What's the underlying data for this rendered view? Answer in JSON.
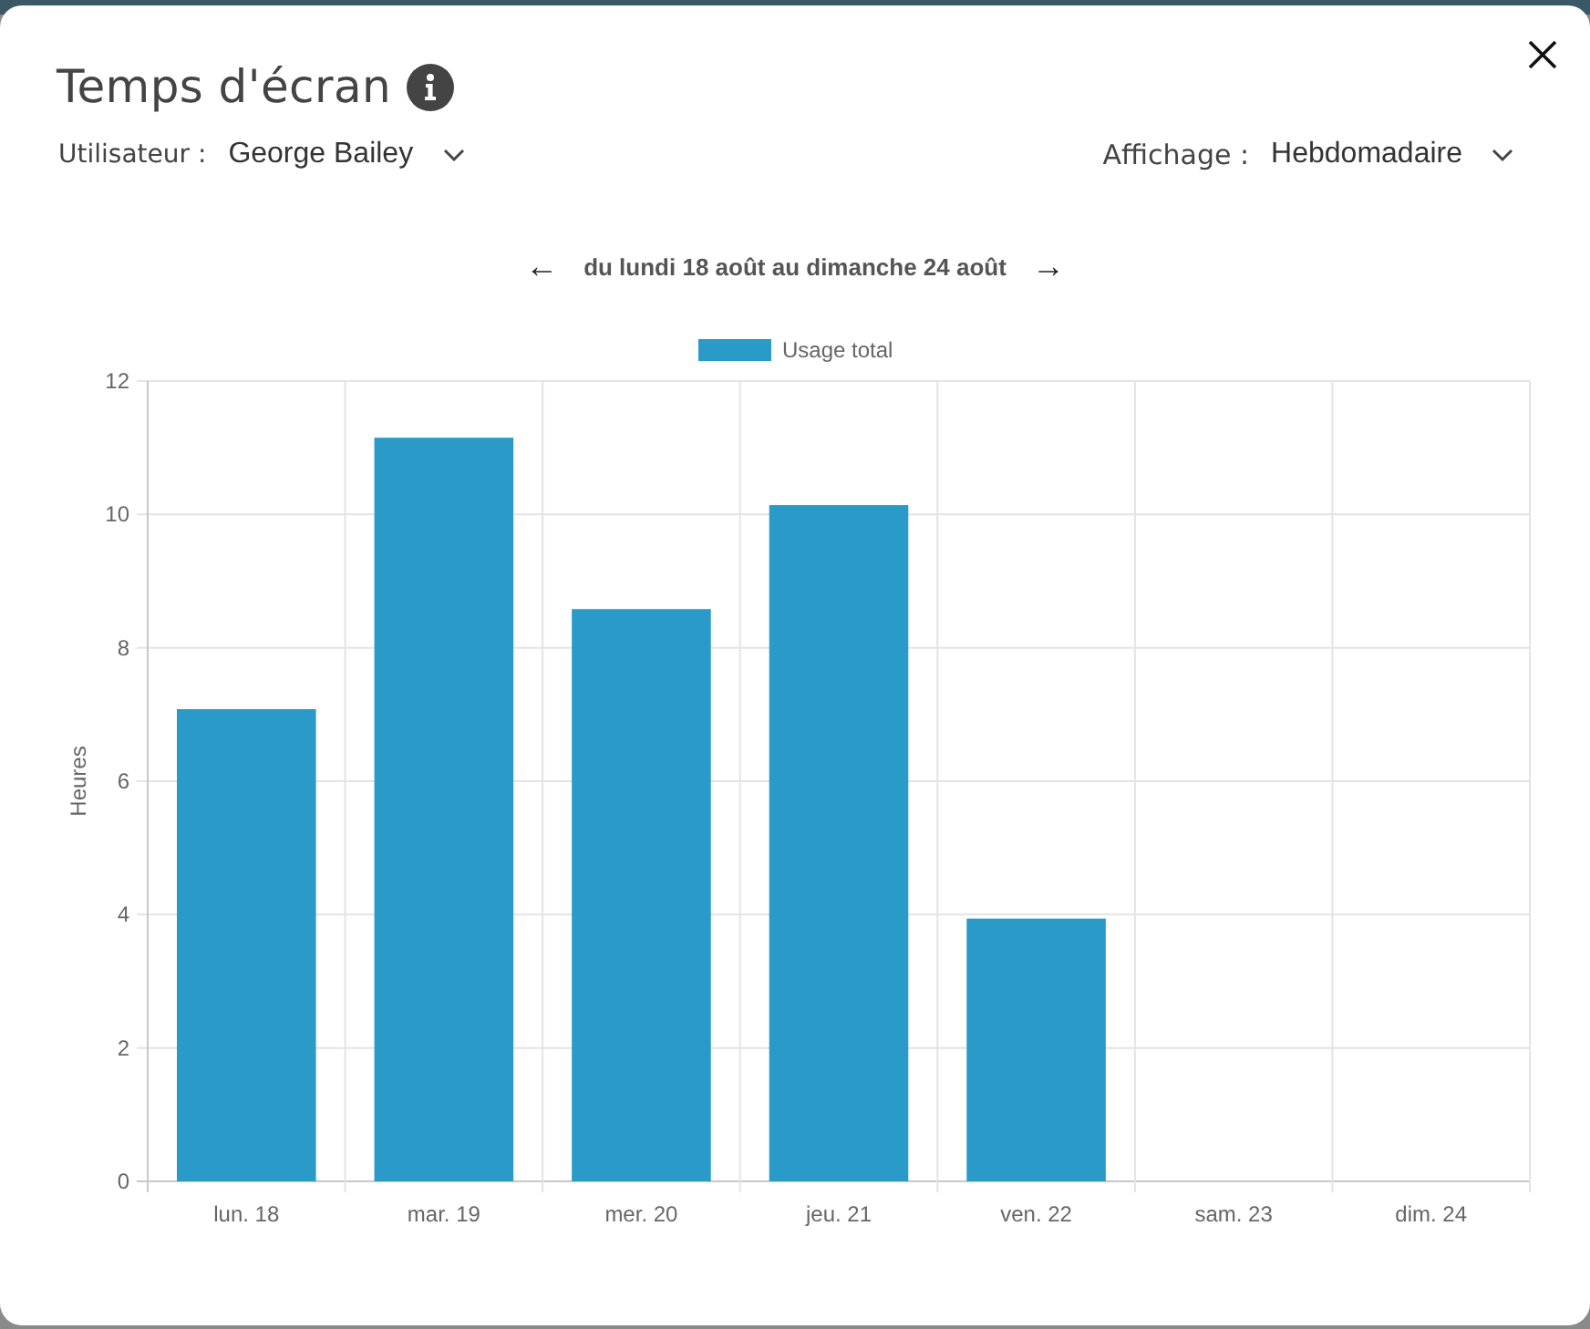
{
  "dialog": {
    "title": "Temps d'écran"
  },
  "filters": [
    {
      "label": "Utilisateur :",
      "value": "George Bailey"
    },
    {
      "label": "Affichage :",
      "value": "Hebdomadaire"
    }
  ],
  "period": {
    "prev": "←",
    "label": "du lundi 18 août au dimanche 24 août",
    "next": "→"
  },
  "chart_data": {
    "type": "bar",
    "ylabel": "Heures",
    "categories": [
      "lun. 18",
      "mar. 19",
      "mer. 20",
      "jeu. 21",
      "ven. 22",
      "sam. 23",
      "dim. 24"
    ],
    "series": [
      {
        "name": "Usage total",
        "color": "#2a9bc9",
        "values": [
          7.08,
          11.15,
          8.58,
          10.14,
          3.94,
          0,
          0
        ]
      }
    ],
    "grid": true,
    "ylim": [
      0,
      12
    ],
    "yticks": [
      0,
      2,
      4,
      6,
      8,
      10,
      12
    ]
  }
}
